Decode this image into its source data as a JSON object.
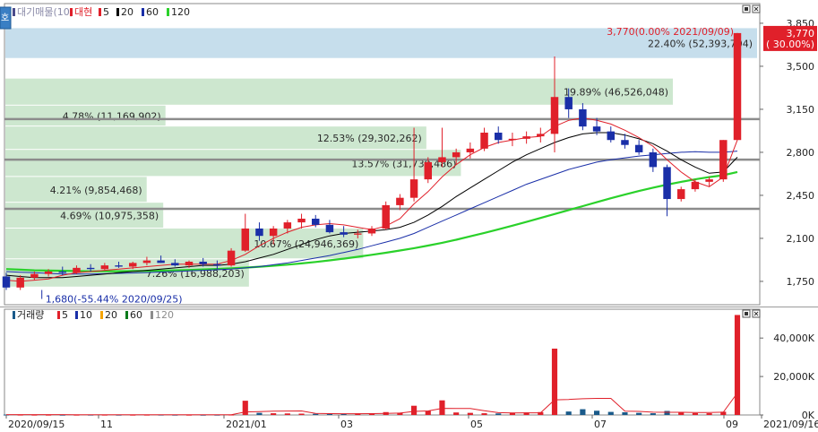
{
  "toolbar": {
    "side_button": "호",
    "price_legend": {
      "name": "대기매물(10)",
      "ticker": "대현",
      "ma": [
        {
          "label": "5",
          "color": "#e0202a"
        },
        {
          "label": "20",
          "color": "#000000"
        },
        {
          "label": "60",
          "color": "#1a2fa8"
        },
        {
          "label": "120",
          "color": "#2ad12a"
        }
      ]
    },
    "volume_legend": {
      "name": "거래량",
      "ma": [
        {
          "label": "5",
          "color": "#e0202a"
        },
        {
          "label": "10",
          "color": "#1a2fa8"
        },
        {
          "label": "20",
          "color": "#f5a300"
        },
        {
          "label": "60",
          "color": "#0a7a1a"
        },
        {
          "label": "120",
          "color": "#8c8c8c"
        }
      ]
    }
  },
  "chart_data": {
    "type": "candlestick",
    "x_tick_labels": [
      "2020/09/15",
      "11",
      "2021/01",
      "03",
      "05",
      "07",
      "09",
      "2021/09/16"
    ],
    "price_axis": {
      "ticks": [
        1750,
        2100,
        2450,
        2800,
        3150,
        3500,
        3850
      ],
      "tick_labels": [
        "1,750",
        "2,100",
        "2,450",
        "2,800",
        "3,150",
        "3,500",
        "3,850"
      ],
      "range": [
        1560,
        4010
      ]
    },
    "volume_axis": {
      "ticks": [
        0,
        20000,
        40000
      ],
      "tick_labels": [
        "0K",
        "20,000K",
        "40,000K"
      ],
      "range": [
        0,
        55000
      ]
    },
    "current_price": {
      "value": 3770,
      "label": "3,770",
      "change": "( 30.00%)",
      "color": "#e0202a"
    },
    "volume_profile": [
      {
        "low": 3560,
        "high": 3810,
        "label": "22.40% (52,393,704)",
        "color": "#c6deec",
        "share": 1.0
      },
      {
        "low": 3180,
        "high": 3400,
        "label": "19.89% (46,526,048)",
        "color": "#cde7cf",
        "share": 0.888
      },
      {
        "low": 3010,
        "high": 3180,
        "label": "4.78% (11,169,902)",
        "color": "#cde7cf",
        "share": 0.213
      },
      {
        "low": 2820,
        "high": 3010,
        "label": "12.53% (29,302,262)",
        "color": "#cde7cf",
        "share": 0.56
      },
      {
        "low": 2600,
        "high": 2820,
        "label": "13.57% (31,739,486)",
        "color": "#cde7cf",
        "share": 0.606
      },
      {
        "low": 2390,
        "high": 2600,
        "label": "4.21% (9,854,468)",
        "color": "#cde7cf",
        "share": 0.188
      },
      {
        "low": 2180,
        "high": 2390,
        "label": "4.69% (10,975,358)",
        "color": "#cde7cf",
        "share": 0.21
      },
      {
        "low": 1930,
        "high": 2180,
        "label": "10.67% (24,946,369)",
        "color": "#cde7cf",
        "share": 0.476
      },
      {
        "low": 1700,
        "high": 1930,
        "label": "7.26% (16,988,203)",
        "color": "#cde7cf",
        "share": 0.324
      }
    ],
    "horizontal_lines": [
      3070,
      2740,
      2340
    ],
    "annotations": [
      {
        "label": "3,770(0.00% 2021/09/09)",
        "value": 3770,
        "color": "#e0202a",
        "at_week": 52
      },
      {
        "label": "1,680(-55.44% 2020/09/25)",
        "value": 1680,
        "color": "#1a2fa8",
        "at_week": 1
      }
    ],
    "candles": [
      {
        "o": 1790,
        "h": 1820,
        "l": 1680,
        "c": 1700
      },
      {
        "o": 1700,
        "h": 1800,
        "l": 1680,
        "c": 1780
      },
      {
        "o": 1780,
        "h": 1830,
        "l": 1760,
        "c": 1810
      },
      {
        "o": 1810,
        "h": 1850,
        "l": 1790,
        "c": 1830
      },
      {
        "o": 1830,
        "h": 1870,
        "l": 1800,
        "c": 1820
      },
      {
        "o": 1820,
        "h": 1880,
        "l": 1810,
        "c": 1860
      },
      {
        "o": 1860,
        "h": 1890,
        "l": 1830,
        "c": 1850
      },
      {
        "o": 1850,
        "h": 1900,
        "l": 1840,
        "c": 1880
      },
      {
        "o": 1880,
        "h": 1910,
        "l": 1860,
        "c": 1870
      },
      {
        "o": 1870,
        "h": 1910,
        "l": 1850,
        "c": 1900
      },
      {
        "o": 1900,
        "h": 1950,
        "l": 1880,
        "c": 1920
      },
      {
        "o": 1920,
        "h": 1960,
        "l": 1900,
        "c": 1900
      },
      {
        "o": 1900,
        "h": 1930,
        "l": 1870,
        "c": 1880
      },
      {
        "o": 1880,
        "h": 1920,
        "l": 1860,
        "c": 1910
      },
      {
        "o": 1910,
        "h": 1940,
        "l": 1870,
        "c": 1890
      },
      {
        "o": 1890,
        "h": 1920,
        "l": 1850,
        "c": 1880
      },
      {
        "o": 1880,
        "h": 2020,
        "l": 1870,
        "c": 2000
      },
      {
        "o": 2000,
        "h": 2300,
        "l": 1990,
        "c": 2180
      },
      {
        "o": 2180,
        "h": 2230,
        "l": 2080,
        "c": 2120
      },
      {
        "o": 2120,
        "h": 2200,
        "l": 2050,
        "c": 2180
      },
      {
        "o": 2180,
        "h": 2250,
        "l": 2140,
        "c": 2230
      },
      {
        "o": 2230,
        "h": 2300,
        "l": 2180,
        "c": 2260
      },
      {
        "o": 2260,
        "h": 2290,
        "l": 2190,
        "c": 2210
      },
      {
        "o": 2210,
        "h": 2250,
        "l": 2140,
        "c": 2150
      },
      {
        "o": 2150,
        "h": 2200,
        "l": 2110,
        "c": 2130
      },
      {
        "o": 2130,
        "h": 2170,
        "l": 2100,
        "c": 2140
      },
      {
        "o": 2140,
        "h": 2200,
        "l": 2120,
        "c": 2180
      },
      {
        "o": 2180,
        "h": 2400,
        "l": 2170,
        "c": 2370
      },
      {
        "o": 2370,
        "h": 2460,
        "l": 2330,
        "c": 2430
      },
      {
        "o": 2430,
        "h": 3000,
        "l": 2400,
        "c": 2580
      },
      {
        "o": 2580,
        "h": 2760,
        "l": 2550,
        "c": 2720
      },
      {
        "o": 2720,
        "h": 3000,
        "l": 2680,
        "c": 2760
      },
      {
        "o": 2760,
        "h": 2830,
        "l": 2700,
        "c": 2800
      },
      {
        "o": 2800,
        "h": 2880,
        "l": 2750,
        "c": 2830
      },
      {
        "o": 2830,
        "h": 3000,
        "l": 2810,
        "c": 2960
      },
      {
        "o": 2960,
        "h": 3010,
        "l": 2870,
        "c": 2900
      },
      {
        "o": 2900,
        "h": 2960,
        "l": 2850,
        "c": 2910
      },
      {
        "o": 2910,
        "h": 2970,
        "l": 2870,
        "c": 2930
      },
      {
        "o": 2930,
        "h": 3000,
        "l": 2880,
        "c": 2950
      },
      {
        "o": 2950,
        "h": 3580,
        "l": 2800,
        "c": 3250
      },
      {
        "o": 3250,
        "h": 3320,
        "l": 3080,
        "c": 3150
      },
      {
        "o": 3150,
        "h": 3200,
        "l": 2980,
        "c": 3010
      },
      {
        "o": 3010,
        "h": 3080,
        "l": 2940,
        "c": 2970
      },
      {
        "o": 2970,
        "h": 3010,
        "l": 2880,
        "c": 2900
      },
      {
        "o": 2900,
        "h": 2950,
        "l": 2830,
        "c": 2860
      },
      {
        "o": 2860,
        "h": 2900,
        "l": 2780,
        "c": 2800
      },
      {
        "o": 2800,
        "h": 2830,
        "l": 2640,
        "c": 2680
      },
      {
        "o": 2680,
        "h": 2700,
        "l": 2280,
        "c": 2420
      },
      {
        "o": 2420,
        "h": 2520,
        "l": 2400,
        "c": 2500
      },
      {
        "o": 2500,
        "h": 2580,
        "l": 2480,
        "c": 2560
      },
      {
        "o": 2560,
        "h": 2600,
        "l": 2520,
        "c": 2580
      },
      {
        "o": 2580,
        "h": 2900,
        "l": 2560,
        "c": 2900
      },
      {
        "o": 2900,
        "h": 3770,
        "l": 2900,
        "c": 3770
      }
    ],
    "series": [
      {
        "name": "5",
        "color": "#e0202a",
        "values": [
          1760,
          1750,
          1760,
          1770,
          1800,
          1820,
          1830,
          1840,
          1850,
          1860,
          1870,
          1880,
          1890,
          1890,
          1890,
          1890,
          1920,
          1970,
          2040,
          2100,
          2150,
          2190,
          2210,
          2220,
          2210,
          2190,
          2170,
          2200,
          2260,
          2380,
          2480,
          2600,
          2700,
          2780,
          2840,
          2880,
          2900,
          2920,
          2930,
          3010,
          3060,
          3080,
          3060,
          3030,
          2980,
          2920,
          2850,
          2740,
          2640,
          2560,
          2520,
          2600,
          2900
        ]
      },
      {
        "name": "20",
        "color": "#000000",
        "values": [
          1800,
          1790,
          1780,
          1780,
          1780,
          1790,
          1800,
          1810,
          1820,
          1830,
          1840,
          1850,
          1860,
          1870,
          1880,
          1880,
          1890,
          1910,
          1940,
          1970,
          2010,
          2050,
          2090,
          2120,
          2140,
          2150,
          2160,
          2170,
          2190,
          2230,
          2290,
          2360,
          2440,
          2510,
          2580,
          2650,
          2720,
          2780,
          2830,
          2880,
          2920,
          2950,
          2960,
          2960,
          2940,
          2910,
          2870,
          2810,
          2740,
          2680,
          2630,
          2640,
          2760
        ]
      },
      {
        "name": "60",
        "color": "#1a2fa8",
        "values": [
          1830,
          1825,
          1820,
          1815,
          1810,
          1810,
          1810,
          1812,
          1815,
          1818,
          1822,
          1826,
          1830,
          1835,
          1840,
          1845,
          1850,
          1860,
          1870,
          1885,
          1900,
          1920,
          1940,
          1960,
          1985,
          2010,
          2040,
          2070,
          2100,
          2140,
          2190,
          2240,
          2290,
          2340,
          2390,
          2440,
          2490,
          2540,
          2580,
          2620,
          2660,
          2690,
          2720,
          2740,
          2755,
          2770,
          2780,
          2790,
          2800,
          2805,
          2800,
          2800,
          2810
        ]
      },
      {
        "name": "120",
        "color": "#2ad12a",
        "values": [
          1850,
          1845,
          1840,
          1838,
          1836,
          1834,
          1832,
          1832,
          1833,
          1834,
          1835,
          1837,
          1840,
          1843,
          1847,
          1851,
          1856,
          1862,
          1869,
          1877,
          1886,
          1896,
          1908,
          1921,
          1935,
          1950,
          1966,
          1983,
          2001,
          2020,
          2041,
          2064,
          2089,
          2116,
          2144,
          2173,
          2203,
          2234,
          2266,
          2298,
          2330,
          2362,
          2394,
          2426,
          2456,
          2485,
          2512,
          2537,
          2560,
          2580,
          2598,
          2614,
          2640
        ]
      }
    ],
    "volume": [
      210,
      180,
      160,
      150,
      140,
      150,
      170,
      160,
      150,
      140,
      160,
      180,
      150,
      140,
      130,
      150,
      210,
      7400,
      1100,
      900,
      800,
      700,
      600,
      500,
      600,
      800,
      900,
      1500,
      1200,
      4800,
      2100,
      7600,
      1300,
      1100,
      900,
      800,
      1200,
      1300,
      1500,
      34500,
      1800,
      3000,
      2200,
      1600,
      1400,
      1100,
      900,
      2100,
      1500,
      1000,
      900,
      1700,
      52000
    ],
    "volume_ma5": [
      200,
      190,
      180,
      170,
      170,
      160,
      160,
      160,
      150,
      150,
      150,
      160,
      160,
      160,
      150,
      150,
      160,
      1580,
      1750,
      1990,
      2050,
      2100,
      770,
      700,
      640,
      660,
      700,
      860,
      1000,
      1850,
      2100,
      3440,
      3380,
      3380,
      2240,
      1220,
      1060,
      1140,
      1140,
      7860,
      8060,
      8420,
      8600,
      8620,
      2000,
      1860,
      1440,
      1420,
      1400,
      1320,
      1280,
      1440,
      11420
    ]
  }
}
